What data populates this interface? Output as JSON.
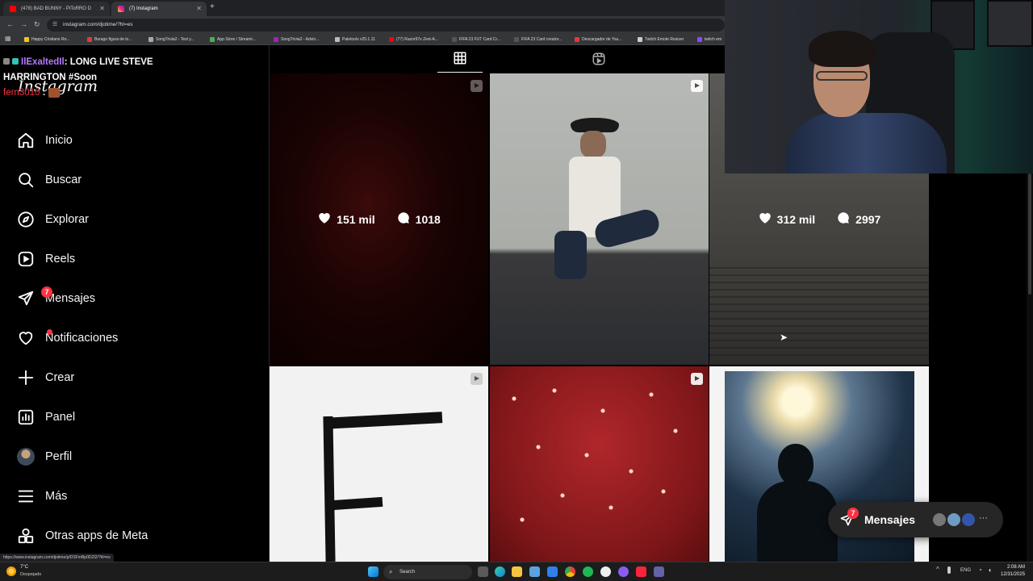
{
  "browser": {
    "tabs": [
      {
        "title": "(478) BAD BUNNY - PiToRRO D",
        "active": false
      },
      {
        "title": "(7) Instagram",
        "active": true
      }
    ],
    "new_tab_label": "+",
    "url": "instagram.com/djotime/?hl=es",
    "bookmarks": [
      "Happy Cristiano Ro...",
      "Burago figura de lo...",
      "SongTrivia2 - Test y...",
      "App Store / Streami...",
      "SongTrivia2 - Advin...",
      "Paletools v25.1.11",
      "(77) Razor97s Zest-A...",
      "FIFA 23 FUT Card Cr...",
      "FIFA 23 Card creator...",
      "Descargador de You...",
      "Twitch Emote Resizer",
      "twitch em"
    ]
  },
  "chat": {
    "username": "IlExaltedIl",
    "message_line1": ": LONG LIVE STEVE",
    "message_line2": "HARRINGTON #Soon",
    "username2": "fern3010",
    "separator2": ":"
  },
  "sidebar": {
    "logo": "Instagram",
    "items": [
      {
        "label": "Inicio",
        "icon": "home-icon"
      },
      {
        "label": "Buscar",
        "icon": "search-icon"
      },
      {
        "label": "Explorar",
        "icon": "compass-icon"
      },
      {
        "label": "Reels",
        "icon": "reels-icon"
      },
      {
        "label": "Mensajes",
        "icon": "messenger-icon",
        "badge": "7"
      },
      {
        "label": "Notificaciones",
        "icon": "heart-icon",
        "dot": true
      },
      {
        "label": "Crear",
        "icon": "plus-icon"
      },
      {
        "label": "Panel",
        "icon": "chart-icon"
      },
      {
        "label": "Perfil",
        "icon": "avatar-icon"
      },
      {
        "label": "Más",
        "icon": "menu-icon"
      },
      {
        "label": "Otras apps de Meta",
        "icon": "meta-apps-icon"
      }
    ]
  },
  "posts": [
    {
      "likes": "151 mil",
      "comments": "1018",
      "hover": true
    },
    {
      "hover": false
    },
    {
      "likes": "312 mil",
      "comments": "2997",
      "hover": true
    },
    {
      "hover": false
    },
    {
      "hover": false
    },
    {
      "hover": false
    }
  ],
  "messages_pill": {
    "label": "Mensajes",
    "badge": "7",
    "more": "···"
  },
  "status_url": "https://www.instagram.com/djotime/p/DSFmBp0DZl2/?hl=es",
  "taskbar": {
    "search": "Search",
    "weather_temp": "7°C",
    "weather_text": "Despejado",
    "lang": "ENG",
    "time": "2:08 AM",
    "date": "12/31/2025"
  },
  "colors": {
    "accent_red": "#ff3040",
    "bg": "#000000"
  }
}
